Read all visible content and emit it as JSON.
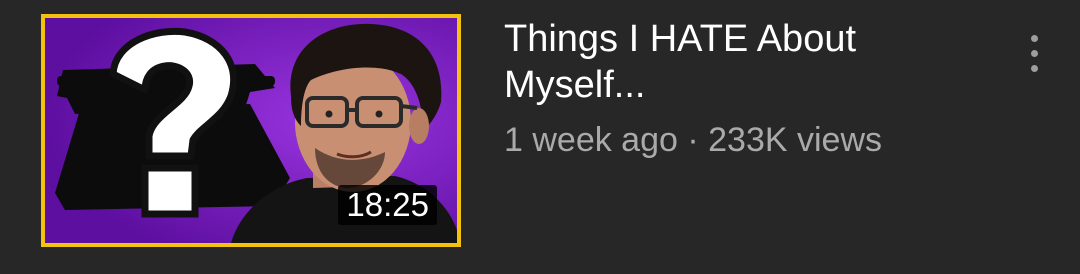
{
  "video": {
    "title": "Things I HATE About Myself...",
    "upload_age": "1 week ago",
    "separator": "·",
    "views": "233K views",
    "duration": "18:25",
    "thumbnail_border_color": "#f2c20f",
    "thumbnail_bg_color": "#7d1fc6"
  },
  "icons": {
    "more": "more-vertical-icon"
  },
  "colors": {
    "background": "#272727",
    "title": "#ffffff",
    "meta": "#aaaaaa"
  }
}
